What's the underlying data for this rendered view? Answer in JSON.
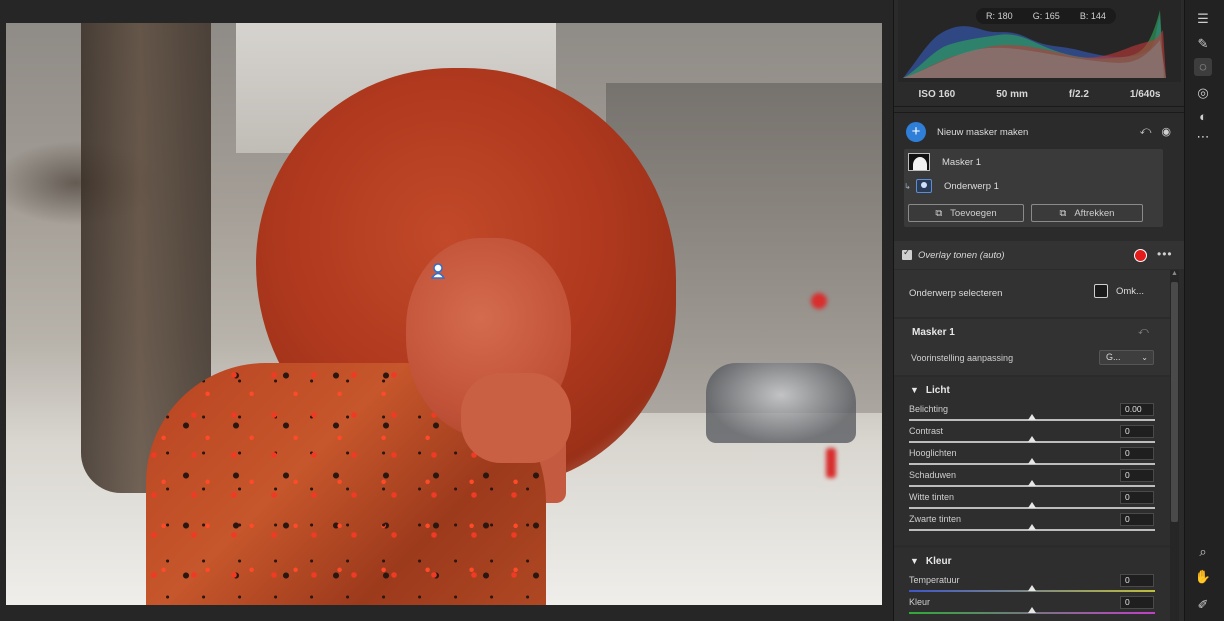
{
  "histogram": {
    "r_label": "R:",
    "r_value": "180",
    "g_label": "G:",
    "g_value": "165",
    "b_label": "B:",
    "b_value": "144"
  },
  "exif": {
    "iso": "ISO 160",
    "focal": "50 mm",
    "aperture": "f/2.2",
    "shutter": "1/640s"
  },
  "masks": {
    "new_mask_label": "Nieuw masker maken",
    "mask_name": "Masker 1",
    "component_name": "Onderwerp 1",
    "add_label": "Toevoegen",
    "subtract_label": "Aftrekken"
  },
  "overlay": {
    "label": "Overlay tonen (auto)",
    "checked": true,
    "color": "#e31b1b"
  },
  "subject": {
    "label": "Onderwerp selecteren",
    "invert_label": "Omk..."
  },
  "mask_panel": {
    "title": "Masker 1",
    "preset_label": "Voorinstelling aanpassing",
    "preset_value": "G..."
  },
  "light": {
    "title": "Licht",
    "sliders": [
      {
        "name": "Belichting",
        "value": "0.00"
      },
      {
        "name": "Contrast",
        "value": "0"
      },
      {
        "name": "Hooglichten",
        "value": "0"
      },
      {
        "name": "Schaduwen",
        "value": "0"
      },
      {
        "name": "Witte tinten",
        "value": "0"
      },
      {
        "name": "Zwarte tinten",
        "value": "0"
      }
    ]
  },
  "color": {
    "title": "Kleur",
    "sliders": [
      {
        "name": "Temperatuur",
        "value": "0"
      },
      {
        "name": "Kleur",
        "value": "0"
      }
    ]
  },
  "rail": [
    "edit-sliders-icon",
    "healing-brush-icon",
    "masking-icon",
    "red-eye-icon",
    "presets-icon",
    "more-icon",
    "zoom-icon",
    "hand-icon",
    "eyedropper-icon"
  ]
}
